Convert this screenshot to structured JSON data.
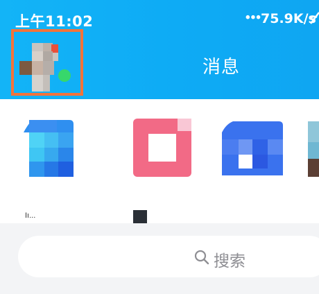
{
  "status_bar": {
    "time": "上午11:02",
    "dots": "•••",
    "speed": "75.9K/s"
  },
  "header": {
    "title": "消息"
  },
  "apps": {
    "app1_label": "Iı...",
    "app2_label": "",
    "app3_label": "",
    "app4_label": ""
  },
  "search": {
    "placeholder": "搜索"
  },
  "colors": {
    "header_bg": "#13b4f7",
    "highlight_frame": "#f3733a",
    "online": "#37d76b"
  }
}
